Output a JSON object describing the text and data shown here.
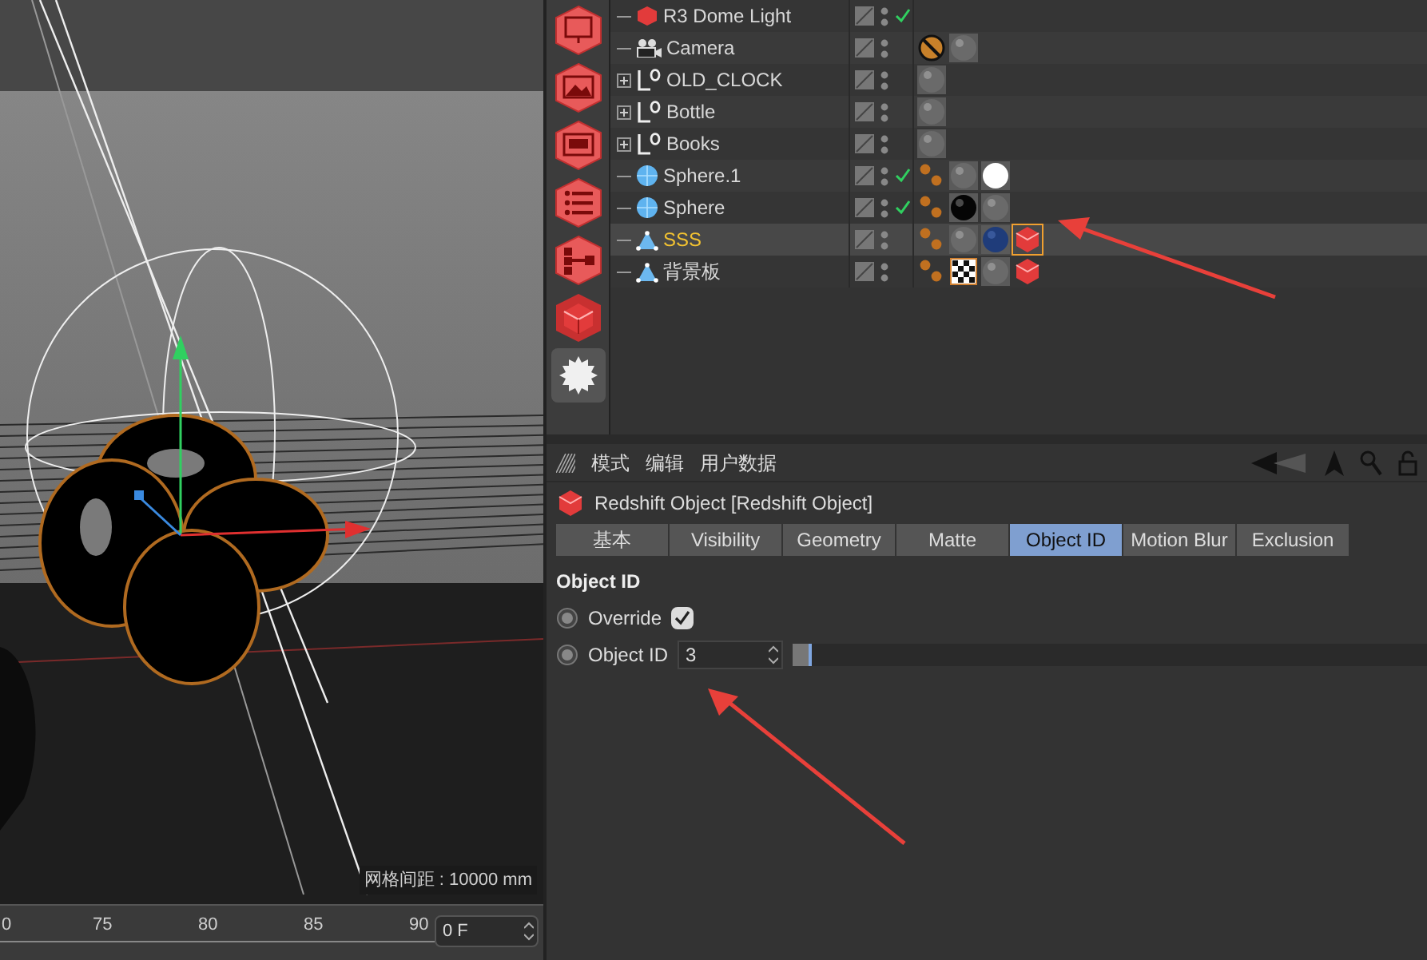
{
  "viewport": {
    "grid_label": "网格间距 : 10000 mm"
  },
  "timeline": {
    "ticks": [
      "0",
      "75",
      "80",
      "85",
      "90"
    ],
    "frame_field": "0 F"
  },
  "tool_icons": [
    {
      "kind": "rv"
    },
    {
      "kind": "picture"
    },
    {
      "kind": "aov"
    },
    {
      "kind": "list"
    },
    {
      "kind": "tree"
    },
    {
      "kind": "cube"
    },
    {
      "kind": "gear"
    }
  ],
  "object_manager": {
    "objects": [
      {
        "name": "R3 Dome Light",
        "kind": "light",
        "expandable": false,
        "selected": false,
        "checked": true
      },
      {
        "name": "Camera",
        "kind": "camera",
        "expandable": false,
        "selected": false,
        "checked": false,
        "tags": [
          {
            "kind": "protection"
          },
          {
            "kind": "material_gray"
          }
        ]
      },
      {
        "name": "OLD_CLOCK",
        "kind": "null",
        "expandable": true,
        "selected": false,
        "checked": false,
        "tags": [
          {
            "kind": "material_gray"
          }
        ]
      },
      {
        "name": "Bottle",
        "kind": "null",
        "expandable": true,
        "selected": false,
        "checked": false,
        "tags": [
          {
            "kind": "material_gray"
          }
        ]
      },
      {
        "name": "Books",
        "kind": "null",
        "expandable": true,
        "selected": false,
        "checked": false,
        "tags": [
          {
            "kind": "material_gray"
          }
        ]
      },
      {
        "name": "Sphere.1",
        "kind": "sphere",
        "expandable": false,
        "selected": false,
        "checked": true,
        "tags": [
          {
            "kind": "phong"
          },
          {
            "kind": "material_gray"
          },
          {
            "kind": "material_white"
          }
        ]
      },
      {
        "name": "Sphere",
        "kind": "sphere",
        "expandable": false,
        "selected": false,
        "checked": true,
        "tags": [
          {
            "kind": "phong"
          },
          {
            "kind": "material_black"
          },
          {
            "kind": "material_gray"
          }
        ]
      },
      {
        "name": "SSS",
        "kind": "polygon",
        "expandable": false,
        "selected": true,
        "checked": false,
        "tags": [
          {
            "kind": "phong"
          },
          {
            "kind": "material_gray"
          },
          {
            "kind": "material_blue"
          },
          {
            "kind": "redshift_active"
          }
        ]
      },
      {
        "name": "背景板",
        "kind": "polygon",
        "expandable": false,
        "selected": false,
        "checked": false,
        "tags": [
          {
            "kind": "phong"
          },
          {
            "kind": "checker"
          },
          {
            "kind": "material_gray"
          },
          {
            "kind": "redshift"
          }
        ]
      }
    ]
  },
  "attribute_manager": {
    "menu": [
      "模式",
      "编辑",
      "用户数据"
    ],
    "title": "Redshift Object [Redshift Object]",
    "tabs": [
      {
        "label": "基本",
        "selected": false
      },
      {
        "label": "Visibility",
        "selected": false
      },
      {
        "label": "Geometry",
        "selected": false
      },
      {
        "label": "Matte",
        "selected": false
      },
      {
        "label": "Object ID",
        "selected": true
      },
      {
        "label": "Motion Blur",
        "selected": false
      },
      {
        "label": "Exclusion",
        "selected": false
      }
    ],
    "section": "Object ID",
    "params": [
      {
        "kind": "checkbox",
        "label": "Override",
        "checked": true
      },
      {
        "kind": "slider",
        "label": "Object ID",
        "value": "3",
        "level": 0.03
      }
    ]
  }
}
